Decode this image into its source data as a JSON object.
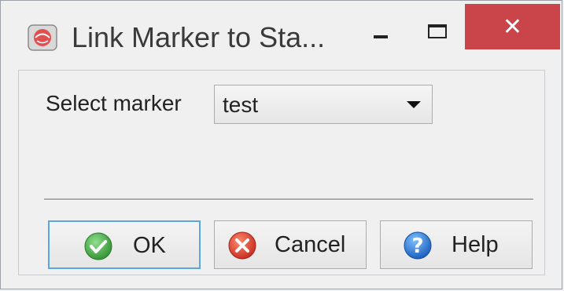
{
  "window": {
    "title": "Link Marker to Sta...",
    "app_icon": "red-globe-icon",
    "controls": {
      "minimize": "minimize-icon",
      "maximize": "maximize-icon",
      "close": "close-icon"
    },
    "close_color": "#c9454a"
  },
  "form": {
    "select_marker_label": "Select marker",
    "marker_value": "test"
  },
  "buttons": {
    "ok_label": "OK",
    "cancel_label": "Cancel",
    "help_label": "Help",
    "ok_icon": "checkmark-icon",
    "cancel_icon": "cancel-x-icon",
    "help_icon": "question-mark-icon"
  },
  "colors": {
    "ok_green": "#3a9d3a",
    "cancel_red": "#d9352c",
    "help_blue": "#1f6fc8",
    "focus_border": "#5aa7e0"
  }
}
